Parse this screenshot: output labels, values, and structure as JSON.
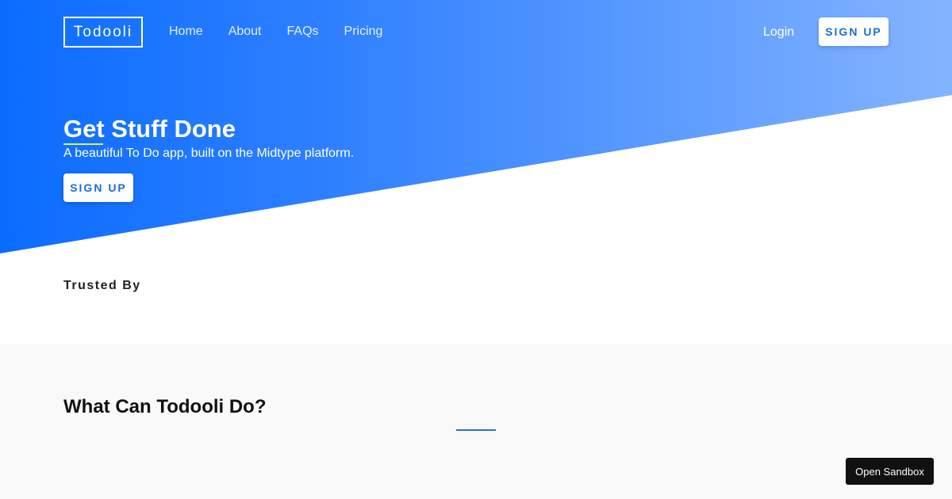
{
  "brand": {
    "logo_text": "Todooli"
  },
  "nav": {
    "links": [
      {
        "label": "Home"
      },
      {
        "label": "About"
      },
      {
        "label": "FAQs"
      },
      {
        "label": "Pricing"
      }
    ],
    "login_label": "Login",
    "signup_label": "SIGN UP"
  },
  "hero": {
    "title": "Get Stuff Done",
    "subtitle": "A beautiful To Do app, built on the Midtype platform.",
    "signup_label": "SIGN UP"
  },
  "trusted": {
    "heading": "Trusted By"
  },
  "features": {
    "heading": "What Can Todooli Do?"
  },
  "sandbox": {
    "label": "Open Sandbox"
  },
  "colors": {
    "hero_gradient_start": "#0a6cff",
    "hero_gradient_end": "#84b4ff",
    "accent_blue": "#1a6fd8",
    "underline_accent": "#d6f541",
    "sandbox_bg": "#111111"
  }
}
